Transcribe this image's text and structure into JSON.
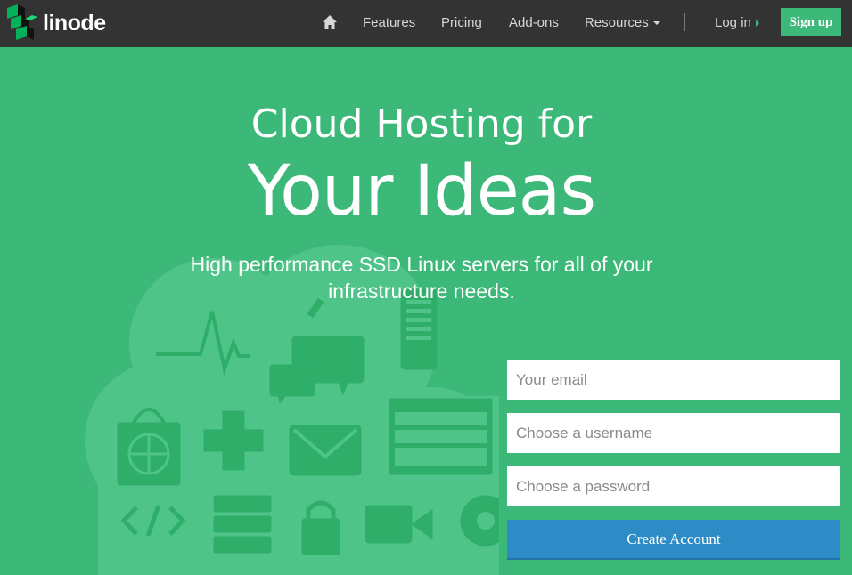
{
  "nav": {
    "logo_text": "linode",
    "items": [
      {
        "label": "Features"
      },
      {
        "label": "Pricing"
      },
      {
        "label": "Add-ons"
      },
      {
        "label": "Resources"
      }
    ],
    "login_label": "Log in",
    "signup_label": "Sign up"
  },
  "hero": {
    "line1": "Cloud Hosting for",
    "line2": "Your Ideas",
    "subtitle_line1": "High performance SSD Linux servers for all of your",
    "subtitle_line2": "infrastructure needs."
  },
  "form": {
    "email_placeholder": "Your email",
    "username_placeholder": "Choose a username",
    "password_placeholder": "Choose a password",
    "submit_label": "Create Account"
  },
  "colors": {
    "nav_bg": "#333333",
    "brand_green": "#3cb878",
    "button_blue": "#2d8bc6"
  },
  "icons": [
    "home-icon",
    "caret-down-icon",
    "arrow-right-icon",
    "cloud-illustration",
    "heartbeat-icon",
    "search-icon",
    "phone-icon",
    "chat-icon",
    "shopping-bag-icon",
    "dpad-icon",
    "envelope-icon",
    "browser-window-icon",
    "code-icon",
    "server-icon",
    "lock-icon",
    "video-icon",
    "gear-icon"
  ]
}
